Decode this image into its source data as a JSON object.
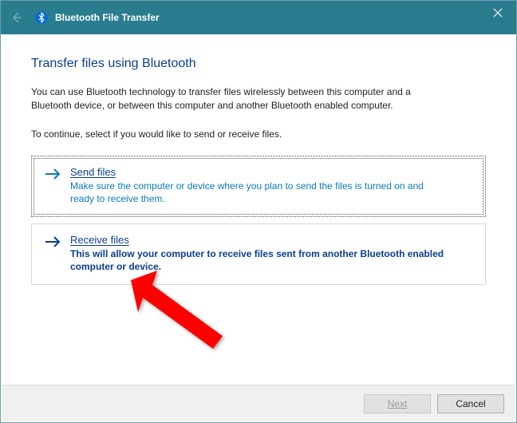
{
  "titlebar": {
    "title": "Bluetooth File Transfer"
  },
  "page": {
    "heading": "Transfer files using Bluetooth",
    "description": "You can use Bluetooth technology to transfer files wirelessly between this computer and a Bluetooth device, or between this computer and another Bluetooth enabled computer.",
    "instruction": "To continue, select if you would like to send or receive files."
  },
  "options": {
    "send": {
      "title": "Send files",
      "description": "Make sure the computer or device where you plan to send the files is turned on and ready to receive them."
    },
    "receive": {
      "title": "Receive files",
      "description": "This will allow your computer to receive files sent from another Bluetooth enabled computer or device."
    }
  },
  "footer": {
    "next": "Next",
    "cancel": "Cancel"
  }
}
